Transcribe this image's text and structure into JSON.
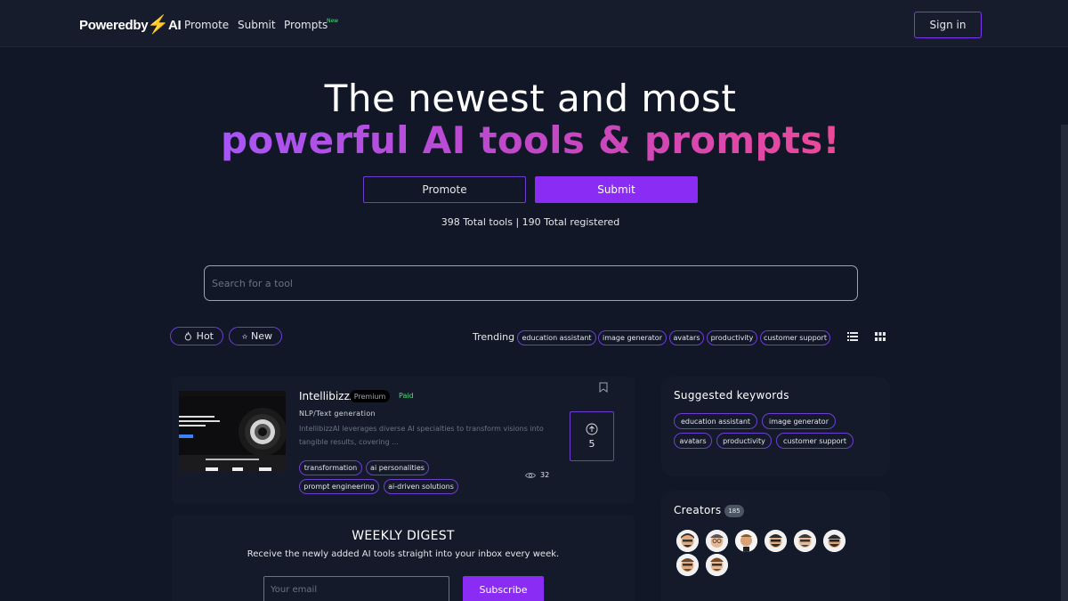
{
  "nav": {
    "logo_left": "Poweredby",
    "logo_right": "AI",
    "links": [
      "Promote",
      "Submit",
      "Prompts"
    ],
    "prompts_badge": "New",
    "signin_label": "Sign in"
  },
  "hero": {
    "line1": "The newest and most",
    "line2": "powerful AI tools & prompts!",
    "promote_label": "Promote",
    "submit_label": "Submit",
    "totals": "398 Total tools | 190 Total registered"
  },
  "search": {
    "placeholder": "Search for a tool"
  },
  "filters": {
    "hot_label": "Hot",
    "new_label": "New",
    "trending_label": "Trending",
    "trending_tags": [
      "education assistant",
      "image generator",
      "avatars",
      "productivity",
      "customer support"
    ]
  },
  "tool_card": {
    "title": "IntellibizzAI",
    "premium_badge": "Premium",
    "pricing": "Paid",
    "category": "NLP/Text generation",
    "description": "IntellibizzAI leverages diverse AI specialties to transform visions into tangible results, covering ...",
    "tags": [
      "transformation",
      "ai personalities",
      "prompt engineering",
      "ai-driven solutions"
    ],
    "votes": "5",
    "views": "32",
    "thumb_headline": "ntellibizzAI:\nour Partner in AI-driven\nolutions",
    "thumb_cta": "Get Started with IntellibizzAI Today"
  },
  "digest": {
    "title": "WEEKLY DIGEST",
    "subtitle": "Receive the newly added AI tools straight into your inbox every week.",
    "email_placeholder": "Your email",
    "subscribe_label": "Subscribe"
  },
  "sidebar": {
    "keywords_title": "Suggested keywords",
    "keywords": [
      "education assistant",
      "image generator",
      "avatars",
      "productivity",
      "customer support"
    ],
    "creators_title": "Creators",
    "creators_count": "185",
    "creator_avatars": 8
  },
  "colors": {
    "background": "#111726",
    "accent": "#8b2cf5",
    "gradient_start": "#a855f7",
    "gradient_end": "#ec4899",
    "paid_green": "#4ade80"
  }
}
